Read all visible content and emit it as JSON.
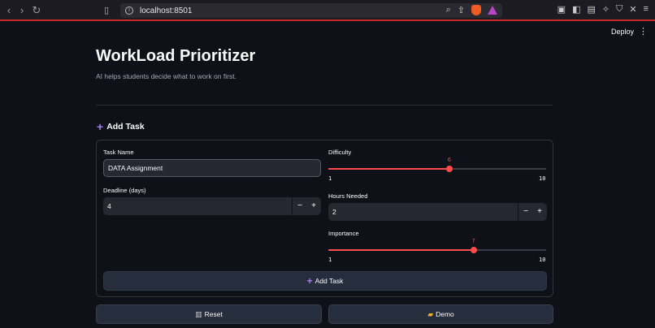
{
  "browser": {
    "url": "localhost:8501"
  },
  "header": {
    "deploy_label": "Deploy"
  },
  "page": {
    "title": "WorkLoad Prioritizer",
    "subtitle": "AI helps students decide what to work on first."
  },
  "section": {
    "heading": "Add Task"
  },
  "form": {
    "task_name": {
      "label": "Task Name",
      "value": "DATA Assignment"
    },
    "deadline": {
      "label": "Deadline (days)",
      "value": "4"
    },
    "difficulty": {
      "label": "Difficulty",
      "value": 6,
      "min": "1",
      "max": "10"
    },
    "hours": {
      "label": "Hours Needed",
      "value": "2"
    },
    "importance": {
      "label": "Importance",
      "value": 7,
      "min": "1",
      "max": "10"
    },
    "submit_label": "Add Task"
  },
  "actions": {
    "reset_label": "Reset",
    "demo_label": "Demo"
  },
  "colors": {
    "accent": "#ff4b4b",
    "background": "#0e1117",
    "input": "#262730",
    "plus": "#a87bf0"
  }
}
